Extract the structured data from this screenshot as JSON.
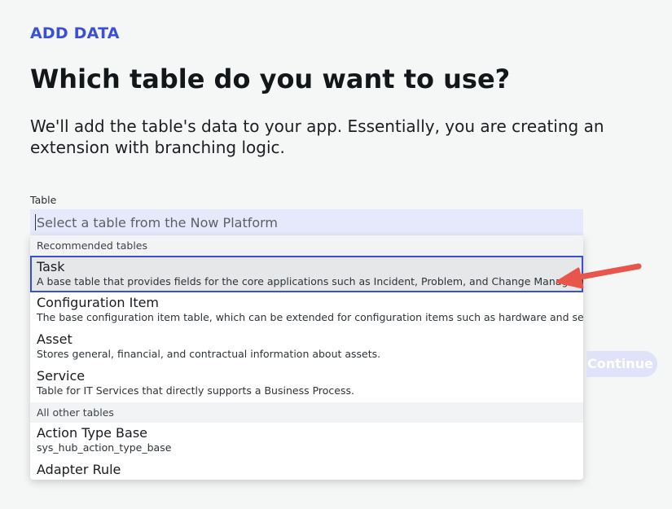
{
  "header": {
    "eyebrow": "ADD DATA",
    "title": "Which table do you want to use?",
    "description": "We'll add the table's data to your app. Essentially, you are creating an extension with branching logic."
  },
  "table_field": {
    "label": "Table",
    "placeholder": "Select a table from the Now Platform",
    "value": ""
  },
  "dropdown": {
    "recommended_header": "Recommended tables",
    "recommended": [
      {
        "label": "Task",
        "description": "A base table that provides fields for the core applications such as Incident, Problem, and Change Management."
      },
      {
        "label": "Configuration Item",
        "description": "The base configuration item table, which can be extended for configuration items such as hardware and services."
      },
      {
        "label": "Asset",
        "description": "Stores general, financial, and contractual information about assets."
      },
      {
        "label": "Service",
        "description": "Table for IT Services that directly supports a Business Process."
      }
    ],
    "other_header": "All other tables",
    "other": [
      {
        "label": "Action Type Base",
        "description": "sys_hub_action_type_base"
      },
      {
        "label": "Adapter Rule",
        "description": ""
      }
    ]
  },
  "buttons": {
    "continue_label": "Continue"
  },
  "colors": {
    "accent": "#3b4fd8",
    "annotation_arrow": "#e8554a",
    "input_bg": "#e5e9fb"
  },
  "icons": {
    "annotation": "arrow-left-icon"
  }
}
